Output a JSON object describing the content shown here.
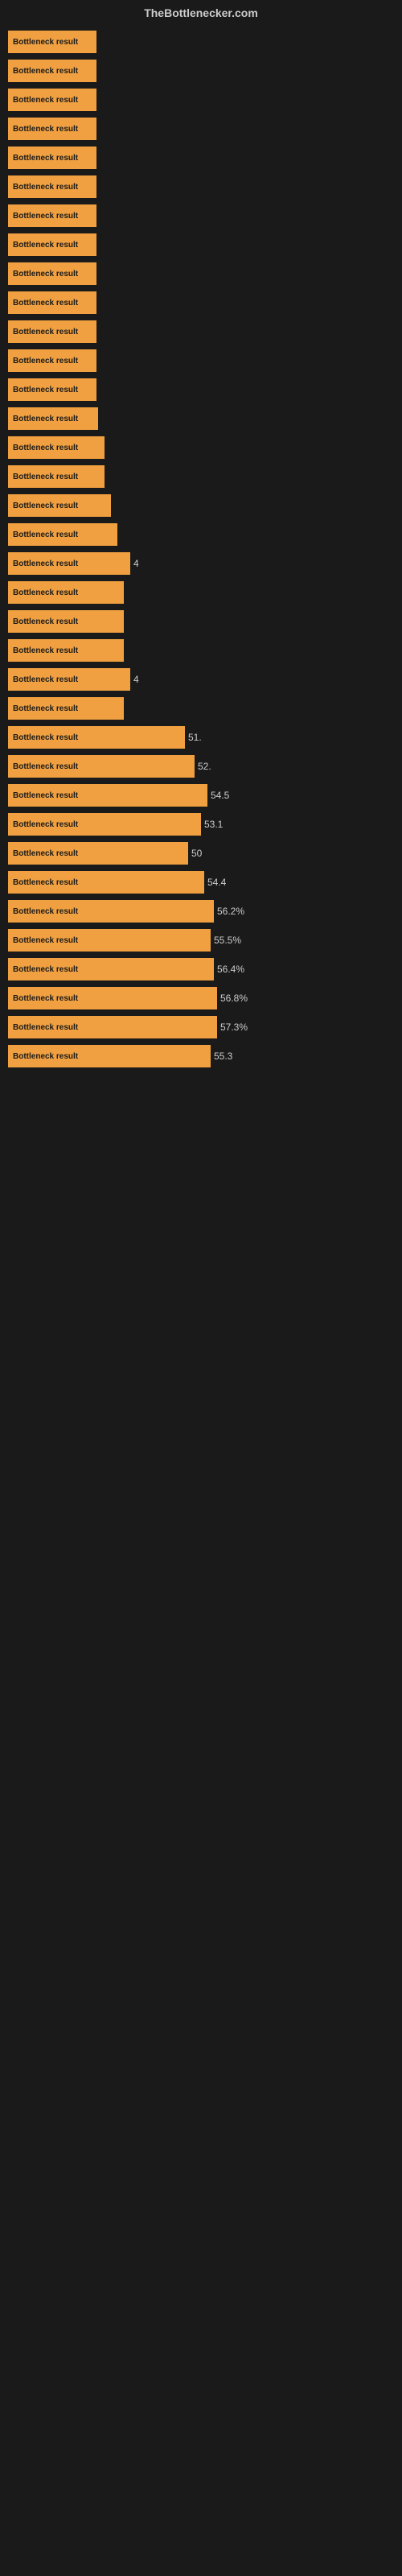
{
  "header": {
    "title": "TheBottlenecker.com"
  },
  "bars": [
    {
      "label": "Bottleneck result",
      "width": 22,
      "value": ""
    },
    {
      "label": "Bottleneck result",
      "width": 22,
      "value": ""
    },
    {
      "label": "Bottleneck result",
      "width": 22,
      "value": ""
    },
    {
      "label": "Bottleneck result",
      "width": 22,
      "value": ""
    },
    {
      "label": "Bottleneck result",
      "width": 22,
      "value": ""
    },
    {
      "label": "Bottleneck result",
      "width": 22,
      "value": ""
    },
    {
      "label": "Bottleneck result",
      "width": 22,
      "value": ""
    },
    {
      "label": "Bottleneck result",
      "width": 22,
      "value": ""
    },
    {
      "label": "Bottleneck result",
      "width": 22,
      "value": ""
    },
    {
      "label": "Bottleneck result",
      "width": 22,
      "value": ""
    },
    {
      "label": "Bottleneck result",
      "width": 24,
      "value": ""
    },
    {
      "label": "Bottleneck result",
      "width": 24,
      "value": ""
    },
    {
      "label": "Bottleneck result",
      "width": 26,
      "value": ""
    },
    {
      "label": "Bottleneck result",
      "width": 28,
      "value": ""
    },
    {
      "label": "Bottleneck result",
      "width": 30,
      "value": ""
    },
    {
      "label": "Bottleneck result",
      "width": 30,
      "value": ""
    },
    {
      "label": "Bottleneck result",
      "width": 32,
      "value": ""
    },
    {
      "label": "Bottleneck result",
      "width": 34,
      "value": ""
    },
    {
      "label": "Bottleneck result",
      "width": 38,
      "value": "4"
    },
    {
      "label": "Bottleneck result",
      "width": 36,
      "value": ""
    },
    {
      "label": "Bottleneck result",
      "width": 36,
      "value": ""
    },
    {
      "label": "Bottleneck result",
      "width": 36,
      "value": ""
    },
    {
      "label": "Bottleneck result",
      "width": 38,
      "value": "4"
    },
    {
      "label": "Bottleneck result",
      "width": 36,
      "value": ""
    },
    {
      "label": "Bottleneck result",
      "width": 55,
      "value": "51."
    },
    {
      "label": "Bottleneck result",
      "width": 58,
      "value": "52."
    },
    {
      "label": "Bottleneck result",
      "width": 62,
      "value": "54.5"
    },
    {
      "label": "Bottleneck result",
      "width": 60,
      "value": "53.1"
    },
    {
      "label": "Bottleneck result",
      "width": 56,
      "value": "50"
    },
    {
      "label": "Bottleneck result",
      "width": 61,
      "value": "54.4"
    },
    {
      "label": "Bottleneck result",
      "width": 64,
      "value": "56.2%"
    },
    {
      "label": "Bottleneck result",
      "width": 63,
      "value": "55.5%"
    },
    {
      "label": "Bottleneck result",
      "width": 64,
      "value": "56.4%"
    },
    {
      "label": "Bottleneck result",
      "width": 65,
      "value": "56.8%"
    },
    {
      "label": "Bottleneck result",
      "width": 65,
      "value": "57.3%"
    },
    {
      "label": "Bottleneck result",
      "width": 63,
      "value": "55.3"
    }
  ]
}
